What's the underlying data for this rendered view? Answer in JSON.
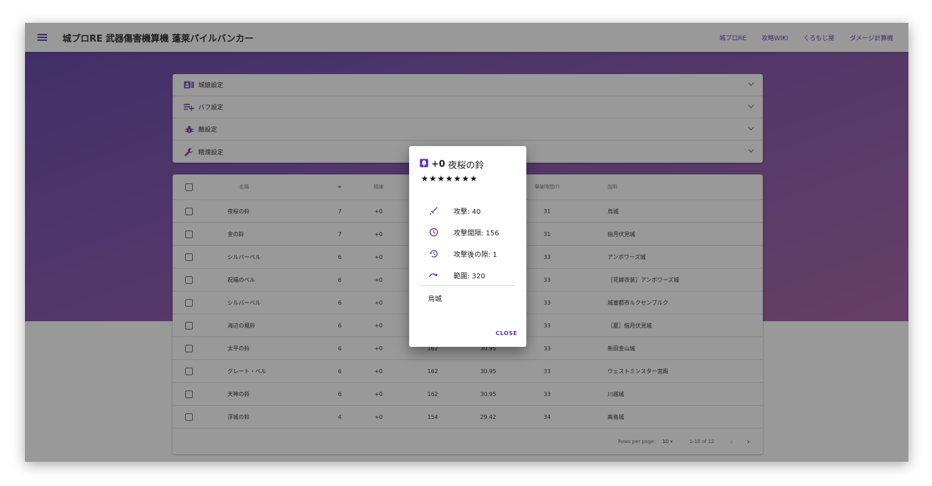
{
  "app": {
    "title": "城プロRE 武器傷害機算機 蓬莱パイルバンカー",
    "nav": [
      "城プロRE",
      "攻略WIKI",
      "くろもじ屋",
      "ダメージ計算機"
    ]
  },
  "panels": [
    {
      "icon": "account-box-icon",
      "label": "城娘設定"
    },
    {
      "icon": "playlist-add-icon",
      "label": "バフ設定"
    },
    {
      "icon": "bug-icon",
      "label": "敵設定"
    },
    {
      "icon": "wrench-icon",
      "label": "精煉設定"
    }
  ],
  "table": {
    "headers": {
      "name": "名稱",
      "rarity": "★",
      "refine": "精煉",
      "break": "撃破時間(f)",
      "desc": "說明"
    },
    "rows": [
      {
        "name": "夜桜の鈴",
        "rarity": "7",
        "refine": "+0",
        "atk": "",
        "dps": "",
        "brk": "31",
        "desc": "烏城"
      },
      {
        "name": "金の鈴",
        "rarity": "7",
        "refine": "+0",
        "atk": "",
        "dps": "",
        "brk": "31",
        "desc": "指月伏見城"
      },
      {
        "name": "シルバーベル",
        "rarity": "6",
        "refine": "+0",
        "atk": "",
        "dps": "",
        "brk": "33",
        "desc": "アンボワーズ城"
      },
      {
        "name": "祝福のベル",
        "rarity": "6",
        "refine": "+0",
        "atk": "",
        "dps": "",
        "brk": "33",
        "desc": "［花嫁衣装］アンボワーズ城"
      },
      {
        "name": "シルバーベル",
        "rarity": "6",
        "refine": "+0",
        "atk": "",
        "dps": "",
        "brk": "33",
        "desc": "城塞都市ルクセンブルク"
      },
      {
        "name": "海辺の風鈴",
        "rarity": "6",
        "refine": "+0",
        "atk": "",
        "dps": "",
        "brk": "33",
        "desc": "［夏］指月伏見城"
      },
      {
        "name": "太平の鈴",
        "rarity": "6",
        "refine": "+0",
        "atk": "162",
        "dps": "30.95",
        "brk": "33",
        "desc": "新田金山城"
      },
      {
        "name": "グレート・ベル",
        "rarity": "6",
        "refine": "+0",
        "atk": "162",
        "dps": "30.95",
        "brk": "33",
        "desc": "ウェストミンスター宮殿"
      },
      {
        "name": "天神の鈴",
        "rarity": "6",
        "refine": "+0",
        "atk": "162",
        "dps": "30.95",
        "brk": "33",
        "desc": "川越城"
      },
      {
        "name": "浮城の鈴",
        "rarity": "4",
        "refine": "+0",
        "atk": "154",
        "dps": "29.42",
        "brk": "34",
        "desc": "高島城"
      }
    ],
    "footer": {
      "rows_per_page_label": "Rows per page:",
      "rows_per_page": "10",
      "range": "1-10 of 12"
    }
  },
  "dialog": {
    "icon": "bell-ring-icon",
    "plus": "+0",
    "name": "夜桜の鈴",
    "stars": "★★★★★★★",
    "stats": [
      {
        "icon": "sword-icon",
        "text": "攻撃: 40"
      },
      {
        "icon": "clock-icon",
        "text": "攻撃間隔: 156"
      },
      {
        "icon": "history-icon",
        "text": "攻撃後の隙: 1"
      },
      {
        "icon": "curve-arrow-icon",
        "text": "範圍: 320"
      }
    ],
    "desc": "烏城",
    "close": "CLOSE"
  },
  "colors": {
    "accent": "#5e35b1",
    "hero_start": "#5b3ea5",
    "hero_end": "#a05aa0"
  }
}
